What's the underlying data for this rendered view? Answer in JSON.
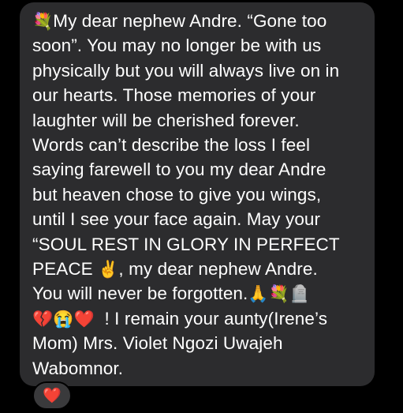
{
  "colors": {
    "background": "#000000",
    "bubble": "#2c2c2e",
    "text": "#ffffff",
    "reaction_bg": "#3a3a3c"
  },
  "message": {
    "lines": [
      {
        "pre": "",
        "emoji": "💐",
        "post": "My dear nephew Andre. “Gone too"
      },
      {
        "text": "soon”. You may no longer be with us"
      },
      {
        "text": "physically but you will always live on in"
      },
      {
        "text": "our hearts. Those memories of your"
      },
      {
        "text": "laughter will be cherished forever."
      },
      {
        "text": "Words can’t describe the loss I feel"
      },
      {
        "text": "saying farewell to you my dear Andre"
      },
      {
        "text": "but heaven chose to give you wings,"
      },
      {
        "text": "until I see your face again. May your"
      },
      {
        "text": "“SOUL REST IN GLORY IN PERFECT"
      },
      {
        "pre": "PEACE ",
        "emoji": "✌️",
        "post": ", my dear nephew Andre."
      },
      {
        "pre": "You will never be forgotten.",
        "emoji": "🙏💐🪦",
        "post": ""
      },
      {
        "pre": "",
        "emoji": "💔😭❤️",
        "post": "  ! I remain your aunty(Irene’s"
      },
      {
        "text": "Mom) Mrs. Violet Ngozi Uwajeh"
      },
      {
        "text": "Wabomnor."
      }
    ]
  },
  "reaction": {
    "emoji": "❤️",
    "icon": "red-heart-icon"
  }
}
